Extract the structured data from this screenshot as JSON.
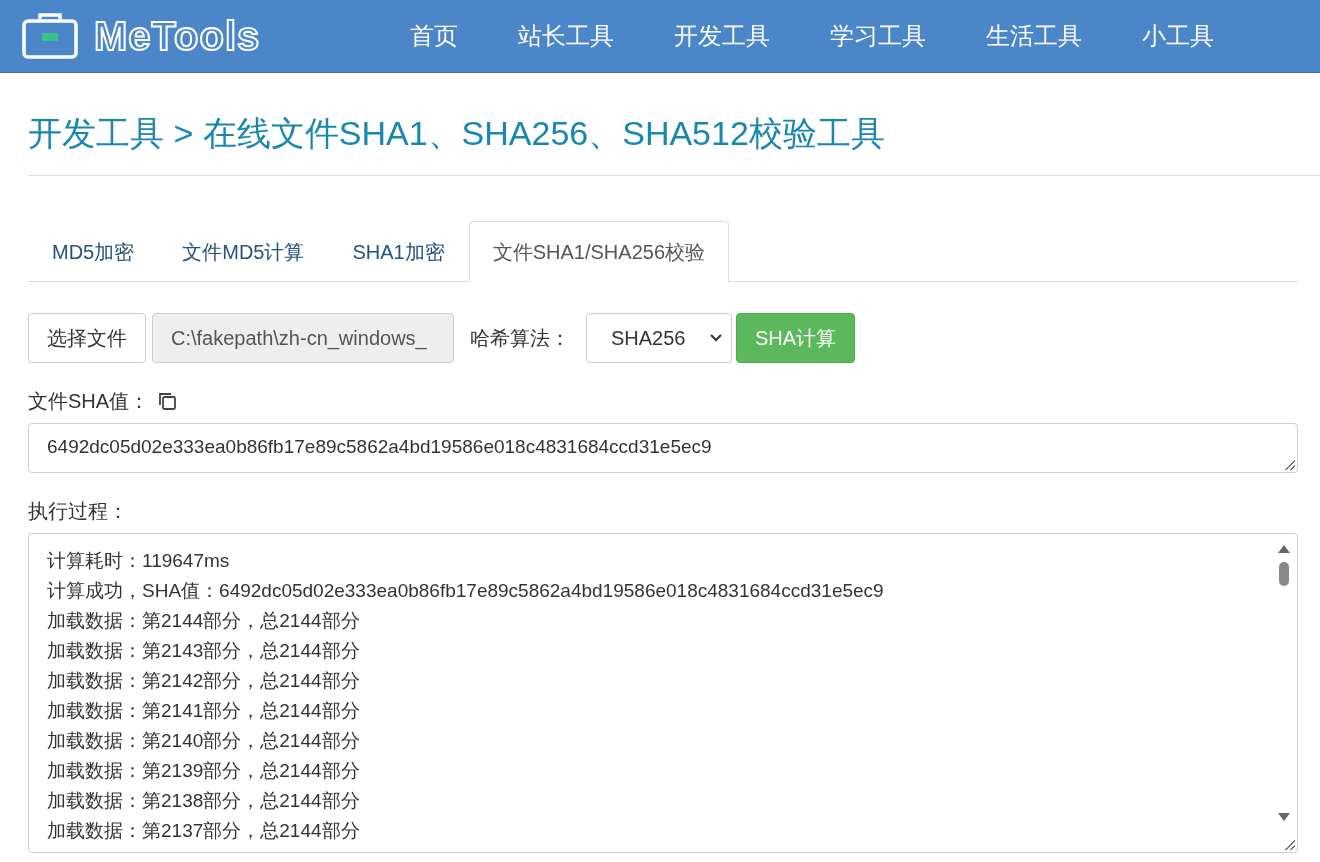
{
  "header": {
    "logo": "MeTools",
    "nav": [
      {
        "label": "首页"
      },
      {
        "label": "站长工具"
      },
      {
        "label": "开发工具"
      },
      {
        "label": "学习工具"
      },
      {
        "label": "生活工具"
      },
      {
        "label": "小工具"
      }
    ]
  },
  "breadcrumb": "开发工具 > 在线文件SHA1、SHA256、SHA512校验工具",
  "tabs": [
    {
      "label": "MD5加密",
      "selected": false
    },
    {
      "label": "文件MD5计算",
      "selected": false
    },
    {
      "label": "SHA1加密",
      "selected": false
    },
    {
      "label": "文件SHA1/SHA256校验",
      "selected": true
    }
  ],
  "form": {
    "choose_button": "选择文件",
    "file_path": "C:\\fakepath\\zh-cn_windows_",
    "algorithm_label": "哈希算法：",
    "algorithm": "SHA256",
    "compute_button": "SHA计算"
  },
  "result": {
    "label": "文件SHA值：",
    "value": "6492dc05d02e333ea0b86fb17e89c5862a4bd19586e018c4831684ccd31e5ec9"
  },
  "log": {
    "label": "执行过程：",
    "lines": [
      "计算耗时：119647ms",
      "计算成功，SHA值：6492dc05d02e333ea0b86fb17e89c5862a4bd19586e018c4831684ccd31e5ec9",
      "加载数据：第2144部分，总2144部分",
      "加载数据：第2143部分，总2144部分",
      "加载数据：第2142部分，总2144部分",
      "加载数据：第2141部分，总2144部分",
      "加载数据：第2140部分，总2144部分",
      "加载数据：第2139部分，总2144部分",
      "加载数据：第2138部分，总2144部分",
      "加载数据：第2137部分，总2144部分"
    ]
  }
}
